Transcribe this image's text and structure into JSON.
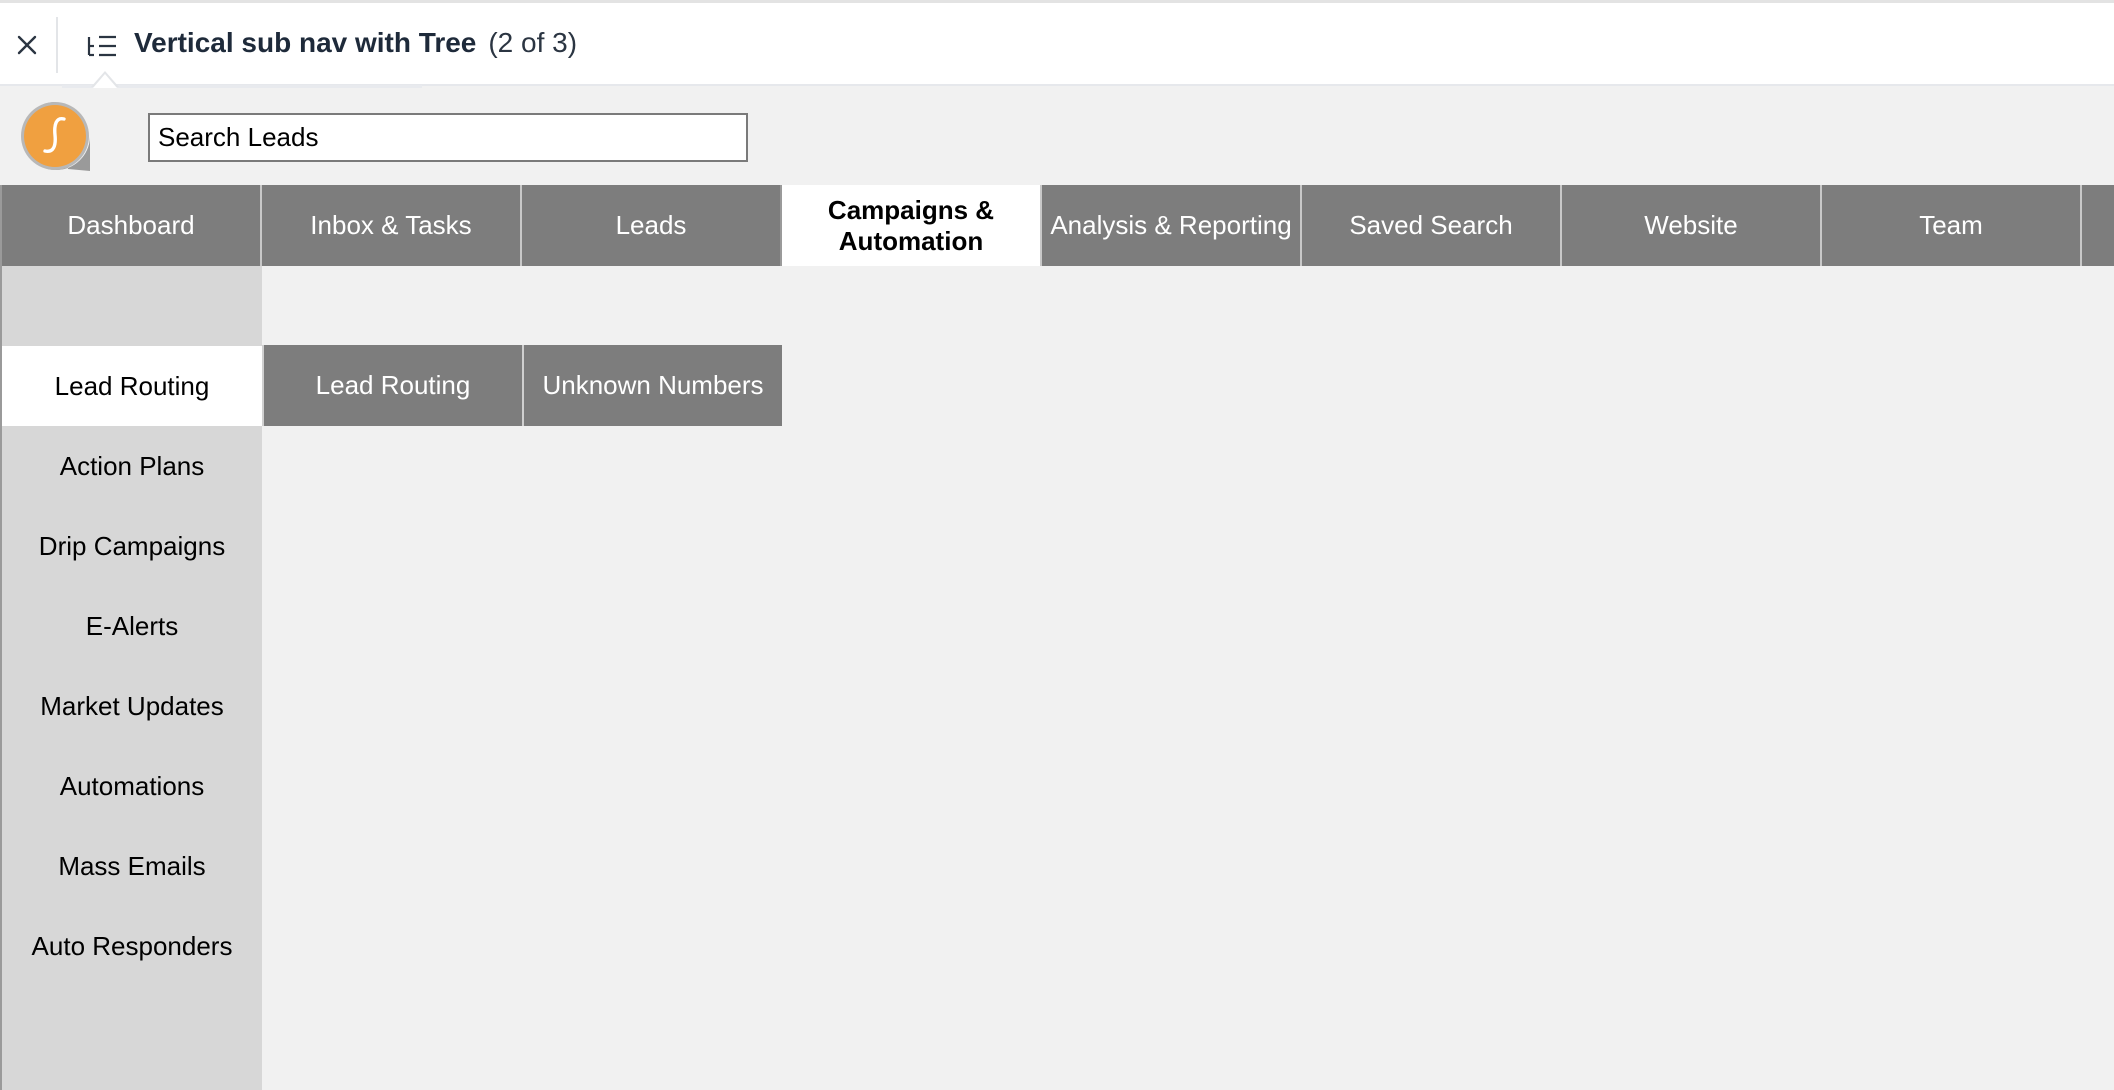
{
  "frame": {
    "title": "Vertical sub nav with Tree",
    "count": "(2 of 3)",
    "close_icon": "close-icon",
    "tree_icon": "tree-list-icon"
  },
  "header": {
    "logo_icon": "brand-logo-icon",
    "search_value": "Search Leads",
    "brand_color": "#f0a040"
  },
  "main_nav": {
    "items": [
      {
        "label": "Dashboard"
      },
      {
        "label": "Inbox & Tasks"
      },
      {
        "label": "Leads"
      },
      {
        "label": "Campaigns & Automation"
      },
      {
        "label": "Analysis & Reporting"
      },
      {
        "label": "Saved Search"
      },
      {
        "label": "Website"
      },
      {
        "label": "Team"
      }
    ],
    "active_index": 3
  },
  "side_nav": {
    "items": [
      {
        "label": "Lead Routing"
      },
      {
        "label": "Action Plans"
      },
      {
        "label": "Drip Campaigns"
      },
      {
        "label": "E-Alerts"
      },
      {
        "label": "Market Updates"
      },
      {
        "label": "Automations"
      },
      {
        "label": "Mass Emails"
      },
      {
        "label": "Auto Responders"
      }
    ],
    "active_index": 0
  },
  "sub_tabs": {
    "items": [
      {
        "label": "Lead Routing"
      },
      {
        "label": "Unknown Numbers"
      }
    ]
  },
  "colors": {
    "nav_bg": "#7d7d7d",
    "side_bg": "#d7d7d7",
    "page_bg": "#f1f1f1",
    "active_bg": "#ffffff"
  }
}
